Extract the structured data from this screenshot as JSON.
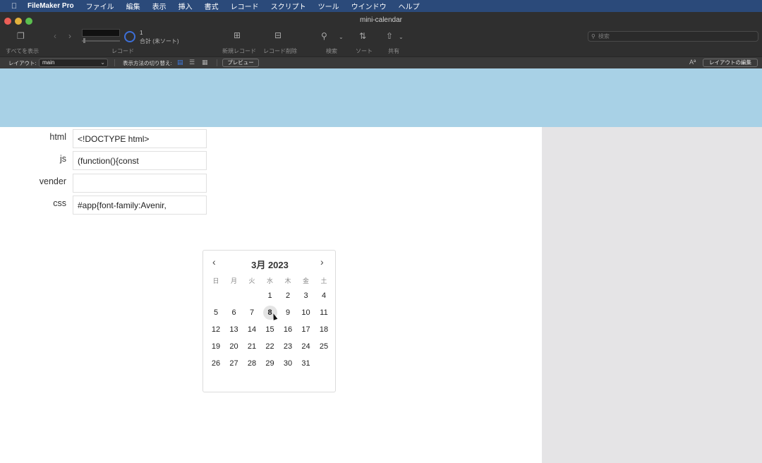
{
  "menubar": {
    "items": [
      "FileMaker Pro",
      "ファイル",
      "編集",
      "表示",
      "挿入",
      "書式",
      "レコード",
      "スクリプト",
      "ツール",
      "ウインドウ",
      "ヘルプ"
    ]
  },
  "window": {
    "title": "mini-calendar"
  },
  "toolbar": {
    "show_all": "すべてを表示",
    "record_label": "レコード",
    "record_count": "1",
    "record_total": "合計 (未ソート)",
    "new_record": "新規レコード",
    "delete_record": "レコード削除",
    "find": "検索",
    "sort": "ソート",
    "share": "共有",
    "search_placeholder": "検索"
  },
  "layoutbar": {
    "layout_label": "レイアウト:",
    "layout_value": "main",
    "view_as_label": "表示方法の切り替え:",
    "preview": "プレビュー",
    "edit_layout": "レイアウトの編集",
    "font_icon": "Aª"
  },
  "fields": [
    {
      "label": "html",
      "value": "<!DOCTYPE html>"
    },
    {
      "label": "js",
      "value": "(function(){const"
    },
    {
      "label": "vender",
      "value": ""
    },
    {
      "label": "css",
      "value": "#app{font-family:Avenir,"
    }
  ],
  "calendar": {
    "title": "3月 2023",
    "weekdays": [
      "日",
      "月",
      "火",
      "水",
      "木",
      "金",
      "土"
    ],
    "first_weekday_index": 3,
    "days_in_month": 31,
    "selected_day": 8
  }
}
